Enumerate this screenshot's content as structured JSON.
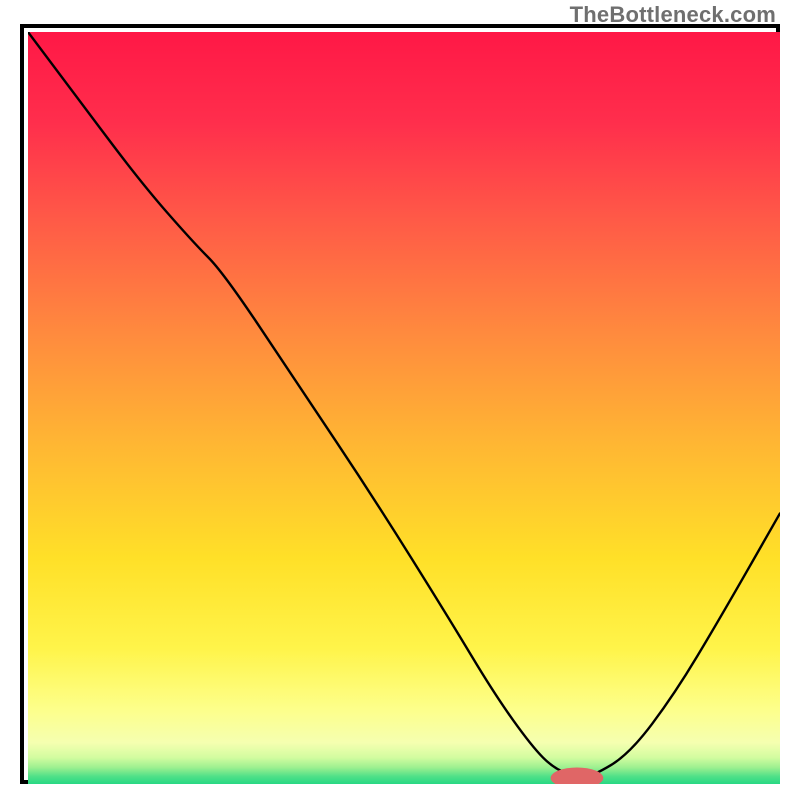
{
  "watermark": "TheBottleneck.com",
  "chart_data": {
    "type": "line",
    "title": "",
    "xlabel": "",
    "ylabel": "",
    "xlim": [
      0,
      100
    ],
    "ylim": [
      0,
      100
    ],
    "grid": false,
    "legend": false,
    "gradient_background": true,
    "series": [
      {
        "name": "curve",
        "x": [
          0,
          6,
          15,
          22,
          26,
          36,
          46,
          56,
          62,
          67,
          70,
          73,
          75,
          80,
          86,
          92,
          100
        ],
        "y": [
          100,
          92,
          80,
          72,
          68,
          53,
          38,
          22,
          12,
          5,
          2,
          1,
          1,
          4,
          12,
          22,
          36
        ]
      }
    ],
    "marker": {
      "x": 73,
      "y": 0.8,
      "rx": 3.5,
      "ry": 1.4,
      "color": "#e06666"
    }
  }
}
